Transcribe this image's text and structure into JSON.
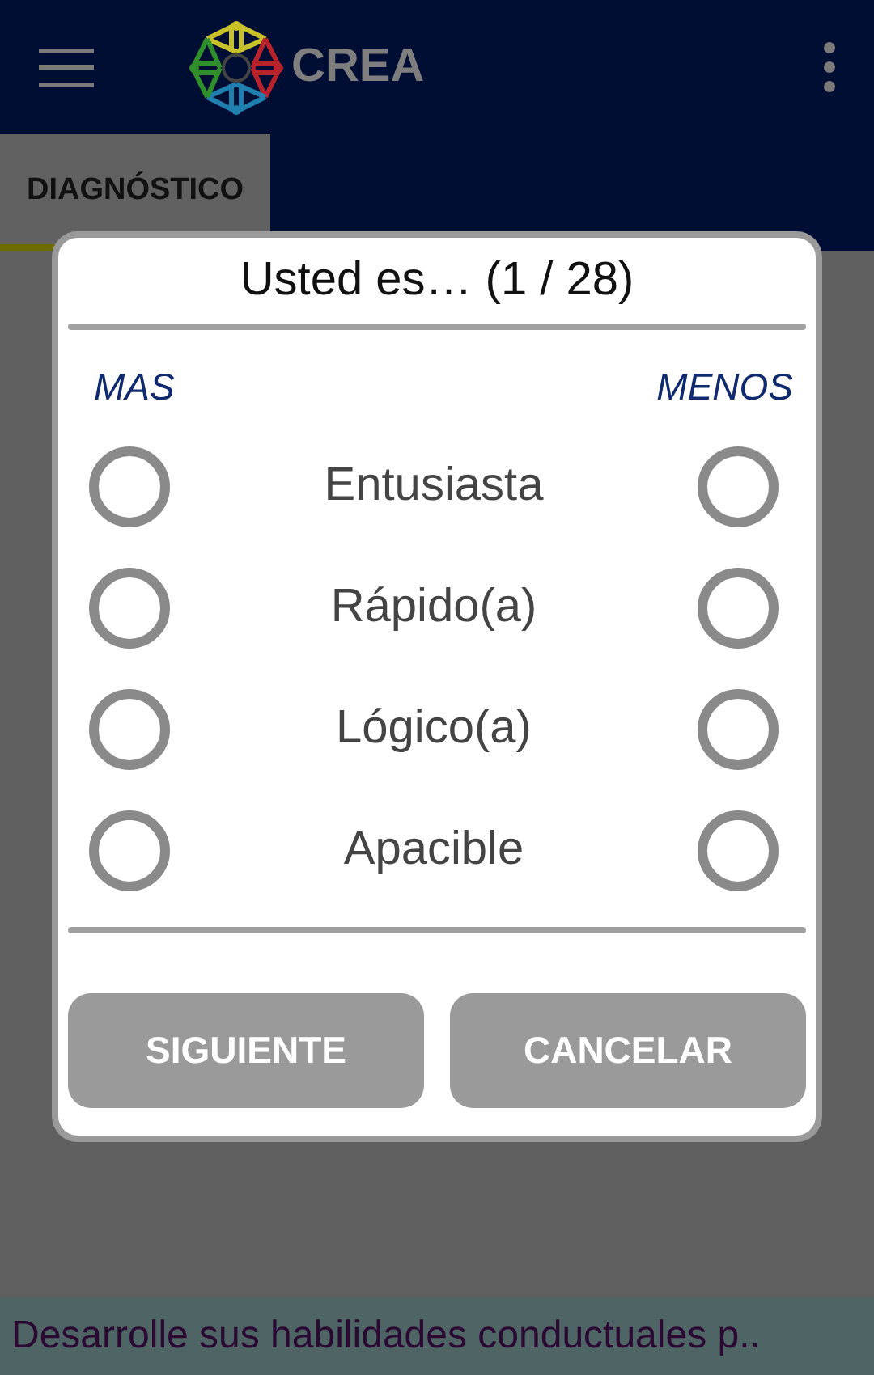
{
  "app_bar": {
    "title": "CREA"
  },
  "tabs": [
    {
      "label": "DIAGNÓSTICO",
      "selected": true
    }
  ],
  "dialog": {
    "title": "Usted es… (1 / 28)",
    "left_heading": "MAS",
    "right_heading": "MENOS",
    "rows": [
      {
        "label": "Entusiasta",
        "mas": {
          "selected": false
        },
        "menos": {
          "selected": false
        }
      },
      {
        "label": "Rápido(a)",
        "mas": {
          "selected": false
        },
        "menos": {
          "selected": false
        }
      },
      {
        "label": "Lógico(a)",
        "mas": {
          "selected": false
        },
        "menos": {
          "selected": false
        }
      },
      {
        "label": "Apacible",
        "mas": {
          "selected": false
        },
        "menos": {
          "selected": false
        }
      }
    ],
    "buttons": [
      "SIGUIENTE",
      "CANCELAR"
    ]
  },
  "banner": {
    "text": "Desarrolle sus habilidades conductuales p.."
  }
}
